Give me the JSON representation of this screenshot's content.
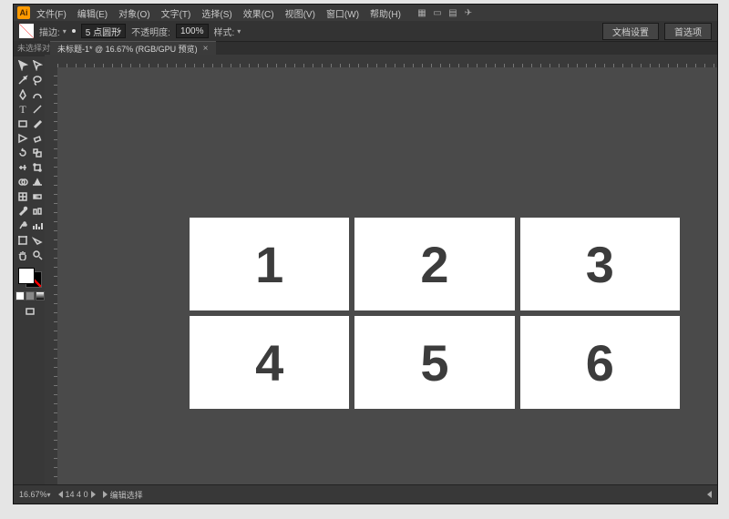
{
  "app_logo_text": "Ai",
  "menu": [
    "文件(F)",
    "编辑(E)",
    "对象(O)",
    "文字(T)",
    "选择(S)",
    "效果(C)",
    "视图(V)",
    "窗口(W)",
    "帮助(H)"
  ],
  "optbar": {
    "no_selection": "未选择对象",
    "stroke_label": "描边:",
    "stroke_pt": "5 点圆形",
    "opacity_label": "不透明度:",
    "opacity_value": "100%",
    "style_label": "样式:",
    "btn_doc_setup": "文档设置",
    "btn_prefs": "首选项"
  },
  "doc_tab": {
    "title": "未标题-1* @ 16.67% (RGB/GPU 预览)",
    "close": "×"
  },
  "cards": [
    "1",
    "2",
    "3",
    "4",
    "5",
    "6"
  ],
  "status": {
    "zoom": "16.67%",
    "nav": "14 4 0",
    "label": "编辑选择"
  },
  "tool_names": [
    [
      "selection",
      "direct-selection"
    ],
    [
      "magic-wand",
      "lasso"
    ],
    [
      "pen",
      "curvature"
    ],
    [
      "type",
      "line"
    ],
    [
      "rectangle",
      "paintbrush"
    ],
    [
      "shaper",
      "eraser"
    ],
    [
      "rotate",
      "scale"
    ],
    [
      "width",
      "free-transform"
    ],
    [
      "shape-builder",
      "perspective"
    ],
    [
      "mesh",
      "gradient"
    ],
    [
      "eyedropper",
      "blend"
    ],
    [
      "symbol-sprayer",
      "column-graph"
    ],
    [
      "artboard",
      "slice"
    ],
    [
      "hand",
      "zoom"
    ]
  ]
}
